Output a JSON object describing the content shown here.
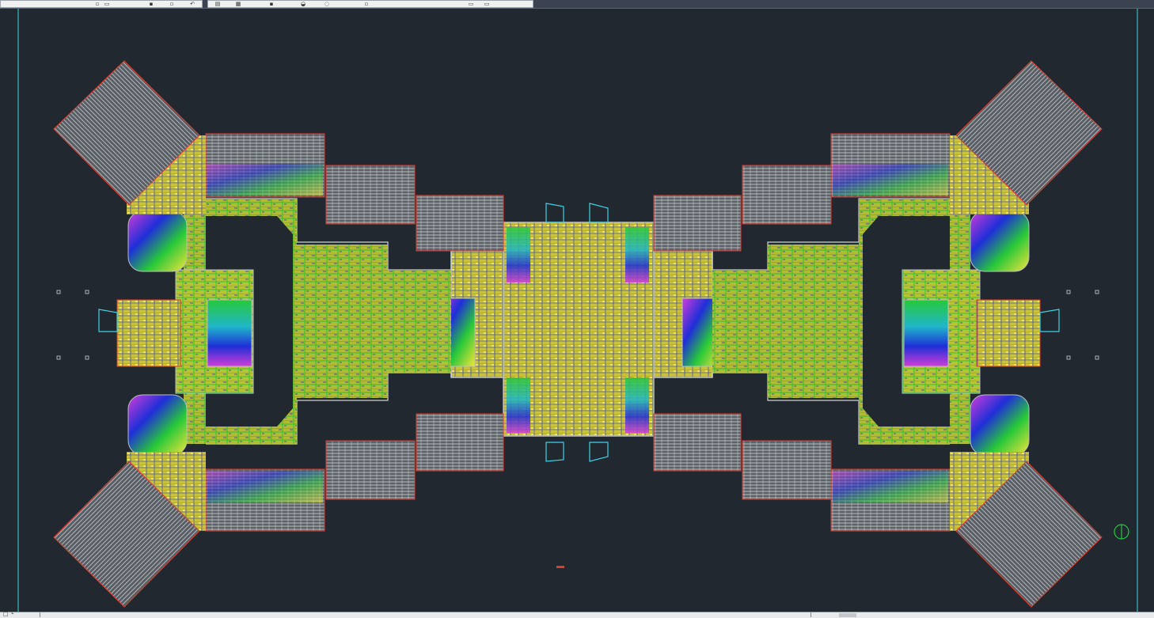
{
  "app": {
    "status_prefix": "□ └"
  },
  "toolbar": {
    "left_group_icons": [
      "file-icon",
      "open-icon",
      "save-icon",
      "print-icon",
      "undo-icon"
    ],
    "right_group_icons": [
      "layer-icon",
      "properties-icon",
      "match-icon",
      "lock-icon",
      "freeze-icon",
      "zoom-icon"
    ]
  },
  "drawing": {
    "background_color": "#212830",
    "border_color": "#3fd2e6",
    "accent_colors": {
      "yellow": "#f3e43a",
      "green": "#27c83a",
      "cyan": "#3fd2e6",
      "blue": "#1f2fd8",
      "magenta": "#d23cd9",
      "red": "#e23b2b",
      "gray": "#b9bec3"
    },
    "north_arrow_icon": "north-arrow-icon"
  }
}
